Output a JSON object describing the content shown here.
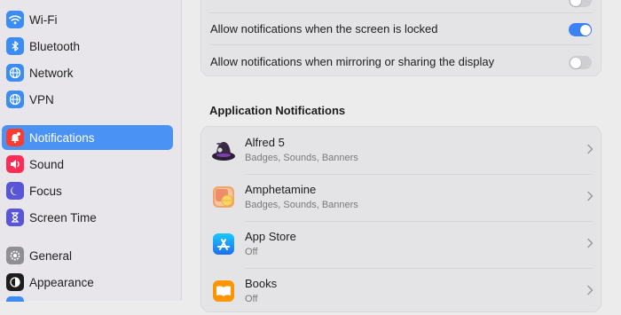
{
  "sidebar": {
    "items": [
      {
        "label": "Wi-Fi",
        "icon": "wifi-icon",
        "color": "#3b8df5"
      },
      {
        "label": "Bluetooth",
        "icon": "bluetooth-icon",
        "color": "#3b8df5"
      },
      {
        "label": "Network",
        "icon": "globe-icon",
        "color": "#3b8df5"
      },
      {
        "label": "VPN",
        "icon": "vpn-globe-icon",
        "color": "#3b8df5"
      },
      {
        "label": "Notifications",
        "icon": "bell-icon",
        "color": "#ff3b30",
        "selected": true
      },
      {
        "label": "Sound",
        "icon": "speaker-icon",
        "color": "#ff2d55"
      },
      {
        "label": "Focus",
        "icon": "moon-icon",
        "color": "#5856d6"
      },
      {
        "label": "Screen Time",
        "icon": "hourglass-icon",
        "color": "#5856d6"
      },
      {
        "label": "General",
        "icon": "gear-icon",
        "color": "#8e8e93"
      },
      {
        "label": "Appearance",
        "icon": "appearance-icon",
        "color": "#1d1d1f"
      }
    ]
  },
  "settings": {
    "locked_label": "Allow notifications when the screen is locked",
    "locked_on": true,
    "mirroring_label": "Allow notifications when mirroring or sharing the display",
    "mirroring_on": false
  },
  "apps": {
    "section_title": "Application Notifications",
    "list": [
      {
        "name": "Alfred 5",
        "detail": "Badges, Sounds, Banners",
        "icon": "alfred-icon"
      },
      {
        "name": "Amphetamine",
        "detail": "Badges, Sounds, Banners",
        "icon": "amphetamine-icon"
      },
      {
        "name": "App Store",
        "detail": "Off",
        "icon": "app-store-icon"
      },
      {
        "name": "Books",
        "detail": "Off",
        "icon": "books-icon"
      }
    ]
  },
  "colors": {
    "accent": "#4b92f5",
    "toggle_on": "#3b82f6"
  }
}
